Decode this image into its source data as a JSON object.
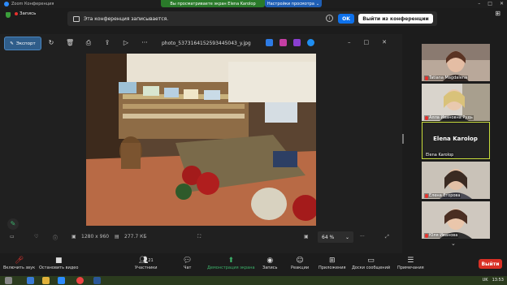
{
  "titlebar": {
    "app_title": "Zoom Конференция",
    "share_status": "Вы просматриваете экран Elena Karolop",
    "view_settings": "Настройки просмотра"
  },
  "recording": {
    "indicator": "Запись"
  },
  "notice": {
    "message": "Эта конференция записывается.",
    "ok_label": "OK",
    "leave_label": "Выйти из конференции"
  },
  "viewer": {
    "edit_label": "Экспорт",
    "filename": "photo_5373164152593445043_y.jpg",
    "dimensions": "1280 x 960",
    "filesize": "277.7 КБ",
    "zoom": "64 %"
  },
  "participants": [
    {
      "name": "Tatiana Magdalena",
      "muted": true
    },
    {
      "name": "Алла Ивановна Рудь",
      "muted": true
    },
    {
      "name": "Elena Karolop",
      "muted": false,
      "active": true
    },
    {
      "name": "Елена Егорова",
      "muted": true
    },
    {
      "name": "Юля Иванова",
      "muted": true
    }
  ],
  "toolbar": {
    "mute": "Включить звук",
    "video": "Остановить видео",
    "participants": "Участники",
    "participants_count": "21",
    "chat": "Чат",
    "share": "Демонстрация экрана",
    "record": "Запись",
    "reactions": "Реакции",
    "apps": "Приложения",
    "whiteboards": "Доски сообщений",
    "notes": "Примечания",
    "leave": "Выйти"
  },
  "taskbar": {
    "lang": "UK",
    "time": "13:53"
  },
  "colors": {
    "accent": "#0e71eb",
    "share_green": "#3db36b",
    "leave_red": "#d93025",
    "active_speaker": "#c8dc3c"
  }
}
